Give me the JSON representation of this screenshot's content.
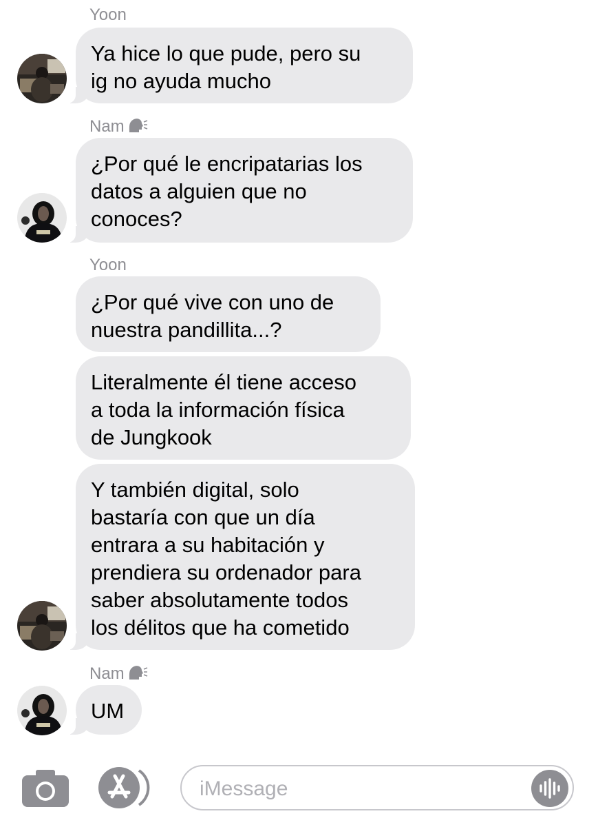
{
  "messages": [
    {
      "sender": "Yoon",
      "avatar": "yoon-avatar",
      "texts": [
        "Ya hice lo que pude, pero su\nig no ayuda mucho"
      ]
    },
    {
      "sender": "Nam",
      "sender_icon": "speaking-head-icon",
      "avatar": "nam-avatar",
      "texts": [
        "¿Por qué le encripatarias los\ndatos a alguien que no\nconoces?"
      ]
    },
    {
      "sender": "Yoon",
      "avatar": "yoon-avatar",
      "texts": [
        "¿Por qué vive con uno de\nnuestra pandillita...?",
        "Literalmente él tiene acceso\na toda la información física\nde Jungkook",
        "Y también digital, solo\nbastaría con que un día\nentrara a su habitación y\nprendiera su ordenador para\nsaber absolutamente todos\nlos délitos que ha cometido"
      ]
    },
    {
      "sender": "Nam",
      "sender_icon": "speaking-head-icon",
      "avatar": "nam-avatar",
      "texts": [
        "UM"
      ]
    }
  ],
  "composer": {
    "camera_icon": "camera-icon",
    "apps_icon": "app-store-icon",
    "placeholder": "iMessage",
    "audio_icon": "audio-waveform-icon"
  },
  "colors": {
    "bubble": "#e9e9eb",
    "sender_label": "#8e8e93",
    "icon_gray": "#8e8e93",
    "background": "#ffffff"
  }
}
